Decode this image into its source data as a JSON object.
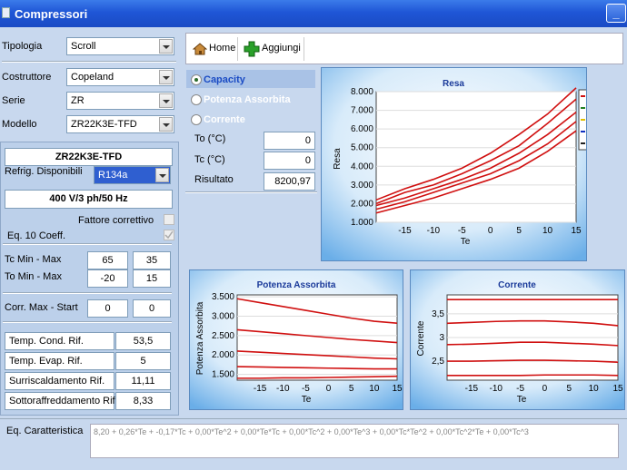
{
  "window": {
    "title": "Compressori"
  },
  "left": {
    "tipologia": {
      "label": "Tipologia",
      "value": "Scroll"
    },
    "costruttore": {
      "label": "Costruttore",
      "value": "Copeland"
    },
    "serie": {
      "label": "Serie",
      "value": "ZR"
    },
    "modello": {
      "label": "Modello",
      "value": "ZR22K3E-TFD"
    },
    "model_name": "ZR22K3E-TFD",
    "refrig_label": "Refrig. Disponibili",
    "refrig_value": "R134a",
    "supply": "400 V/3 ph/50 Hz",
    "fattore_label": "Fattore correttivo",
    "eq10_label": "Eq. 10 Coeff.",
    "tc_label": "Tc Min - Max",
    "tc_min": "65",
    "tc_max": "35",
    "to_label": "To Min - Max",
    "to_min": "-20",
    "to_max": "15",
    "corr_label": "Corr. Max - Start",
    "corr_max": "0",
    "corr_start": "0",
    "rif": [
      {
        "label": "Temp. Cond. Rif.",
        "value": "53,5"
      },
      {
        "label": "Temp. Evap. Rif.",
        "value": "5"
      },
      {
        "label": "Surriscaldamento Rif.",
        "value": "11,11"
      },
      {
        "label": "Sottoraffreddamento Rif.",
        "value": "8,33"
      }
    ]
  },
  "toolbar": {
    "home": "Home",
    "add": "Aggiungi"
  },
  "mode": {
    "capacity": "Capacity",
    "potenza": "Potenza Assorbita",
    "corrente": "Corrente"
  },
  "calc": {
    "to_label": "To (°C)",
    "to_value": "0",
    "tc_label": "Tc (°C)",
    "tc_value": "0",
    "result_label": "Risultato",
    "result_value": "8200,97"
  },
  "eq": {
    "label": "Eq. Caratteristica",
    "value": "8,20 + 0,26*Te + -0,17*Tc + 0,00*Te^2 + 0,00*Te*Tc + 0,00*Tc^2 + 0,00*Te^3 + 0,00*Tc*Te^2 + 0,00*Tc^2*Te + 0,00*Tc^3"
  },
  "colors": {
    "curve": "#d01010",
    "chart_bg": "#6aaee8",
    "accent": "#1f56d6"
  },
  "chart_data": [
    {
      "id": "resa",
      "type": "line",
      "title": "Resa",
      "xlabel": "Te",
      "ylabel": "Resa",
      "xlim": [
        -20,
        15
      ],
      "ylim": [
        1000,
        8000
      ],
      "xticks": [
        "-15",
        "-10",
        "-5",
        "0",
        "5",
        "10",
        "15"
      ],
      "xtick_values": [
        -15,
        -10,
        -5,
        0,
        5,
        10,
        15
      ],
      "yticks": [
        "1.000",
        "2.000",
        "3.000",
        "4.000",
        "5.000",
        "6.000",
        "7.000",
        "8.000"
      ],
      "ytick_values": [
        1000,
        2000,
        3000,
        4000,
        5000,
        6000,
        7000,
        8000
      ],
      "legend": [
        "65",
        "58",
        "50",
        "43",
        "35"
      ],
      "legend_colors": [
        "#d01010",
        "#208020",
        "#e0c000",
        "#1030c0",
        "#202020"
      ],
      "x": [
        -20,
        -15,
        -10,
        -5,
        0,
        5,
        10,
        15
      ],
      "series": [
        {
          "name": "65",
          "values": [
            1500,
            1900,
            2300,
            2800,
            3300,
            3900,
            4800,
            5900
          ]
        },
        {
          "name": "58",
          "values": [
            1700,
            2100,
            2600,
            3100,
            3600,
            4300,
            5200,
            6400
          ]
        },
        {
          "name": "50",
          "values": [
            1900,
            2300,
            2800,
            3300,
            3900,
            4700,
            5700,
            6900
          ]
        },
        {
          "name": "43",
          "values": [
            2000,
            2600,
            3000,
            3600,
            4300,
            5100,
            6300,
            7600
          ]
        },
        {
          "name": "35",
          "values": [
            2200,
            2800,
            3300,
            3900,
            4700,
            5700,
            6800,
            8200
          ]
        }
      ]
    },
    {
      "id": "potenza",
      "type": "line",
      "title": "Potenza Assorbita",
      "xlabel": "Te",
      "ylabel": "Potenza Assorbita",
      "xlim": [
        -20,
        15
      ],
      "ylim": [
        1350,
        3550
      ],
      "xticks": [
        "-15",
        "-10",
        "-5",
        "0",
        "5",
        "10",
        "15"
      ],
      "xtick_values": [
        -15,
        -10,
        -5,
        0,
        5,
        10,
        15
      ],
      "yticks": [
        "1.500",
        "2.000",
        "2.500",
        "3.000",
        "3.500"
      ],
      "ytick_values": [
        1500,
        2000,
        2500,
        3000,
        3500
      ],
      "x": [
        -20,
        -15,
        -10,
        -5,
        0,
        5,
        10,
        15
      ],
      "series": [
        {
          "values": [
            3450,
            3350,
            3250,
            3150,
            3050,
            2950,
            2870,
            2820
          ]
        },
        {
          "values": [
            2650,
            2600,
            2550,
            2500,
            2450,
            2400,
            2360,
            2320
          ]
        },
        {
          "values": [
            2100,
            2070,
            2040,
            2010,
            1980,
            1950,
            1920,
            1900
          ]
        },
        {
          "values": [
            1700,
            1690,
            1680,
            1670,
            1660,
            1650,
            1640,
            1640
          ]
        },
        {
          "values": [
            1400,
            1400,
            1410,
            1410,
            1420,
            1430,
            1440,
            1450
          ]
        }
      ]
    },
    {
      "id": "corrente",
      "type": "line",
      "title": "Corrente",
      "xlabel": "Te",
      "ylabel": "Corrente",
      "xlim": [
        -20,
        15
      ],
      "ylim": [
        2.1,
        3.9
      ],
      "xticks": [
        "-15",
        "-10",
        "-5",
        "0",
        "5",
        "10",
        "15"
      ],
      "xtick_values": [
        -15,
        -10,
        -5,
        0,
        5,
        10,
        15
      ],
      "yticks": [
        "2,5",
        "3",
        "3,5"
      ],
      "ytick_values": [
        2.5,
        3,
        3.5
      ],
      "x": [
        -20,
        -15,
        -10,
        -5,
        0,
        5,
        10,
        15
      ],
      "series": [
        {
          "values": [
            3.8,
            3.8,
            3.8,
            3.8,
            3.8,
            3.8,
            3.8,
            3.8
          ]
        },
        {
          "values": [
            3.3,
            3.32,
            3.34,
            3.35,
            3.35,
            3.33,
            3.3,
            3.25
          ]
        },
        {
          "values": [
            2.85,
            2.86,
            2.88,
            2.9,
            2.9,
            2.88,
            2.86,
            2.83
          ]
        },
        {
          "values": [
            2.5,
            2.5,
            2.51,
            2.52,
            2.52,
            2.51,
            2.5,
            2.48
          ]
        },
        {
          "values": [
            2.2,
            2.2,
            2.2,
            2.2,
            2.21,
            2.21,
            2.21,
            2.2
          ]
        }
      ]
    }
  ]
}
